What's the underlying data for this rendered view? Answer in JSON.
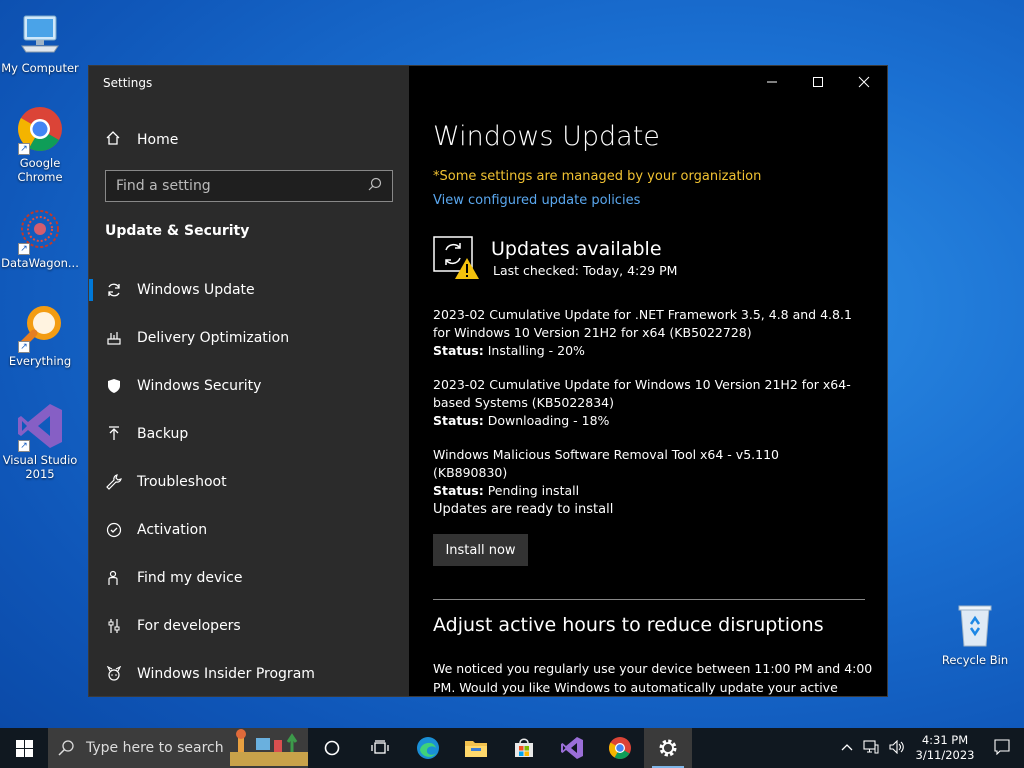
{
  "desktop": {
    "icons": [
      {
        "label": "My Computer"
      },
      {
        "label": "Google Chrome"
      },
      {
        "label": "DataWagon..."
      },
      {
        "label": "Everything"
      },
      {
        "label": "Visual Studio 2015"
      },
      {
        "label": "Recycle Bin"
      }
    ]
  },
  "window": {
    "title": "Settings",
    "caption": {
      "minimize": "—",
      "maximize": "☐",
      "close": "✕"
    }
  },
  "sidebar": {
    "home": "Home",
    "search_placeholder": "Find a setting",
    "section": "Update & Security",
    "items": [
      {
        "label": "Windows Update",
        "icon": "refresh-icon"
      },
      {
        "label": "Delivery Optimization",
        "icon": "delivery-icon"
      },
      {
        "label": "Windows Security",
        "icon": "shield-icon"
      },
      {
        "label": "Backup",
        "icon": "backup-icon"
      },
      {
        "label": "Troubleshoot",
        "icon": "wrench-icon"
      },
      {
        "label": "Activation",
        "icon": "check-circle-icon"
      },
      {
        "label": "Find my device",
        "icon": "person-icon"
      },
      {
        "label": "For developers",
        "icon": "sliders-icon"
      },
      {
        "label": "Windows Insider Program",
        "icon": "insider-icon"
      }
    ]
  },
  "main": {
    "title": "Windows Update",
    "managed_notice": "*Some settings are managed by your organization",
    "policies_link": "View configured update policies",
    "status_heading": "Updates available",
    "last_checked": "Last checked: Today, 4:29 PM",
    "updates": [
      {
        "name": "2023-02 Cumulative Update for .NET Framework 3.5, 4.8 and 4.8.1 for Windows 10 Version 21H2 for x64 (KB5022728)",
        "status_label": "Status:",
        "status": "Installing - 20%"
      },
      {
        "name": "2023-02 Cumulative Update for Windows 10 Version 21H2 for x64-based Systems (KB5022834)",
        "status_label": "Status:",
        "status": "Downloading - 18%"
      },
      {
        "name": "Windows Malicious Software Removal Tool x64 - v5.110 (KB890830)",
        "status_label": "Status:",
        "status": "Pending install"
      }
    ],
    "ready_text": "Updates are ready to install",
    "install_button": "Install now",
    "active_hours_title": "Adjust active hours to reduce disruptions",
    "active_hours_text": "We noticed you regularly use your device between 11:00 PM and 4:00 PM. Would you like Windows to automatically update your active"
  },
  "taskbar": {
    "search_placeholder": "Type here to search",
    "time": "4:31 PM",
    "date": "3/11/2023"
  },
  "colors": {
    "accent": "#0078d7",
    "warning_text": "#f1c232",
    "link": "#5aa7ee"
  }
}
